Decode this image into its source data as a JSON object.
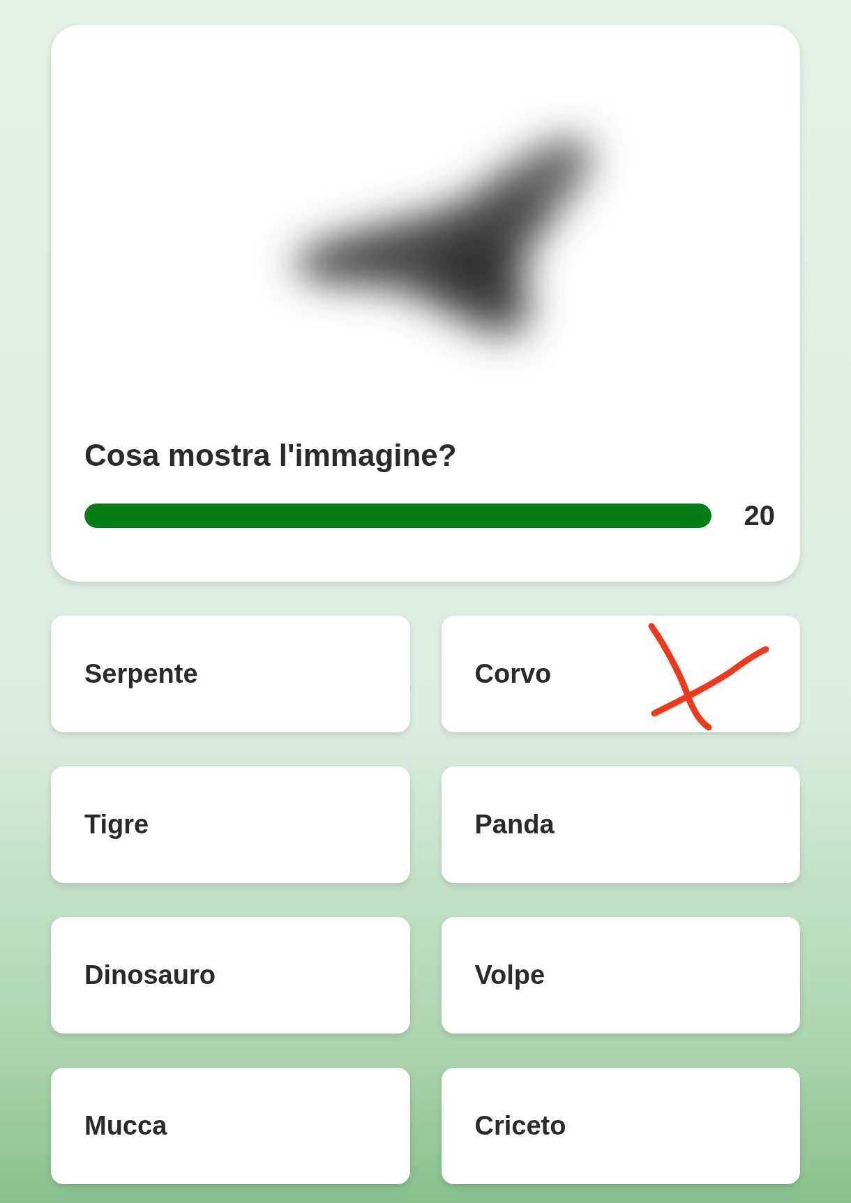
{
  "question": {
    "text": "Cosa mostra l'immagine?",
    "timer": {
      "reading": "20"
    }
  },
  "options": [
    {
      "label": "Serpente",
      "crossed": false
    },
    {
      "label": "Corvo",
      "crossed": true
    },
    {
      "label": "Tigre",
      "crossed": false
    },
    {
      "label": "Panda",
      "crossed": false
    },
    {
      "label": "Dinosauro",
      "crossed": false
    },
    {
      "label": "Volpe",
      "crossed": false
    },
    {
      "label": "Mucca",
      "crossed": false
    },
    {
      "label": "Criceto",
      "crossed": false
    }
  ]
}
